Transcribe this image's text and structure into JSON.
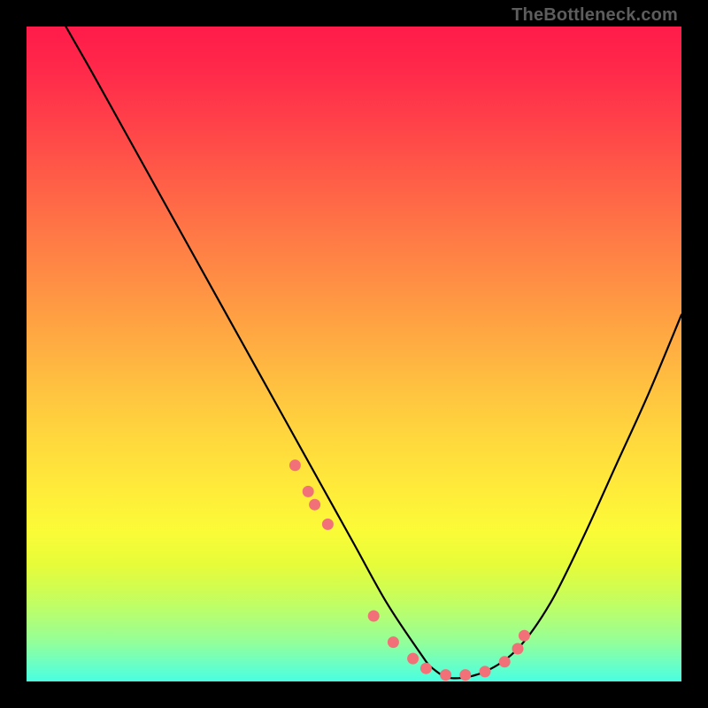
{
  "watermark": "TheBottleneck.com",
  "chart_data": {
    "type": "line",
    "title": "",
    "xlabel": "",
    "ylabel": "",
    "xlim": [
      0,
      100
    ],
    "ylim": [
      0,
      100
    ],
    "series": [
      {
        "name": "curve",
        "x": [
          6,
          10,
          15,
          20,
          25,
          30,
          35,
          40,
          45,
          50,
          55,
          60,
          62,
          65,
          70,
          75,
          80,
          85,
          90,
          95,
          100
        ],
        "y": [
          100,
          93,
          84,
          75,
          66,
          57,
          48,
          39,
          30,
          21,
          12,
          4.5,
          2,
          0.5,
          1.5,
          5,
          12,
          22,
          33,
          44,
          56
        ]
      }
    ],
    "markers": {
      "name": "dots",
      "color": "#f27179",
      "x": [
        41,
        43,
        44,
        46,
        53,
        56,
        59,
        61,
        64,
        67,
        70,
        73,
        75,
        76
      ],
      "y": [
        33,
        29,
        27,
        24,
        10,
        6,
        3.5,
        2,
        1,
        1,
        1.5,
        3,
        5,
        7
      ]
    }
  }
}
